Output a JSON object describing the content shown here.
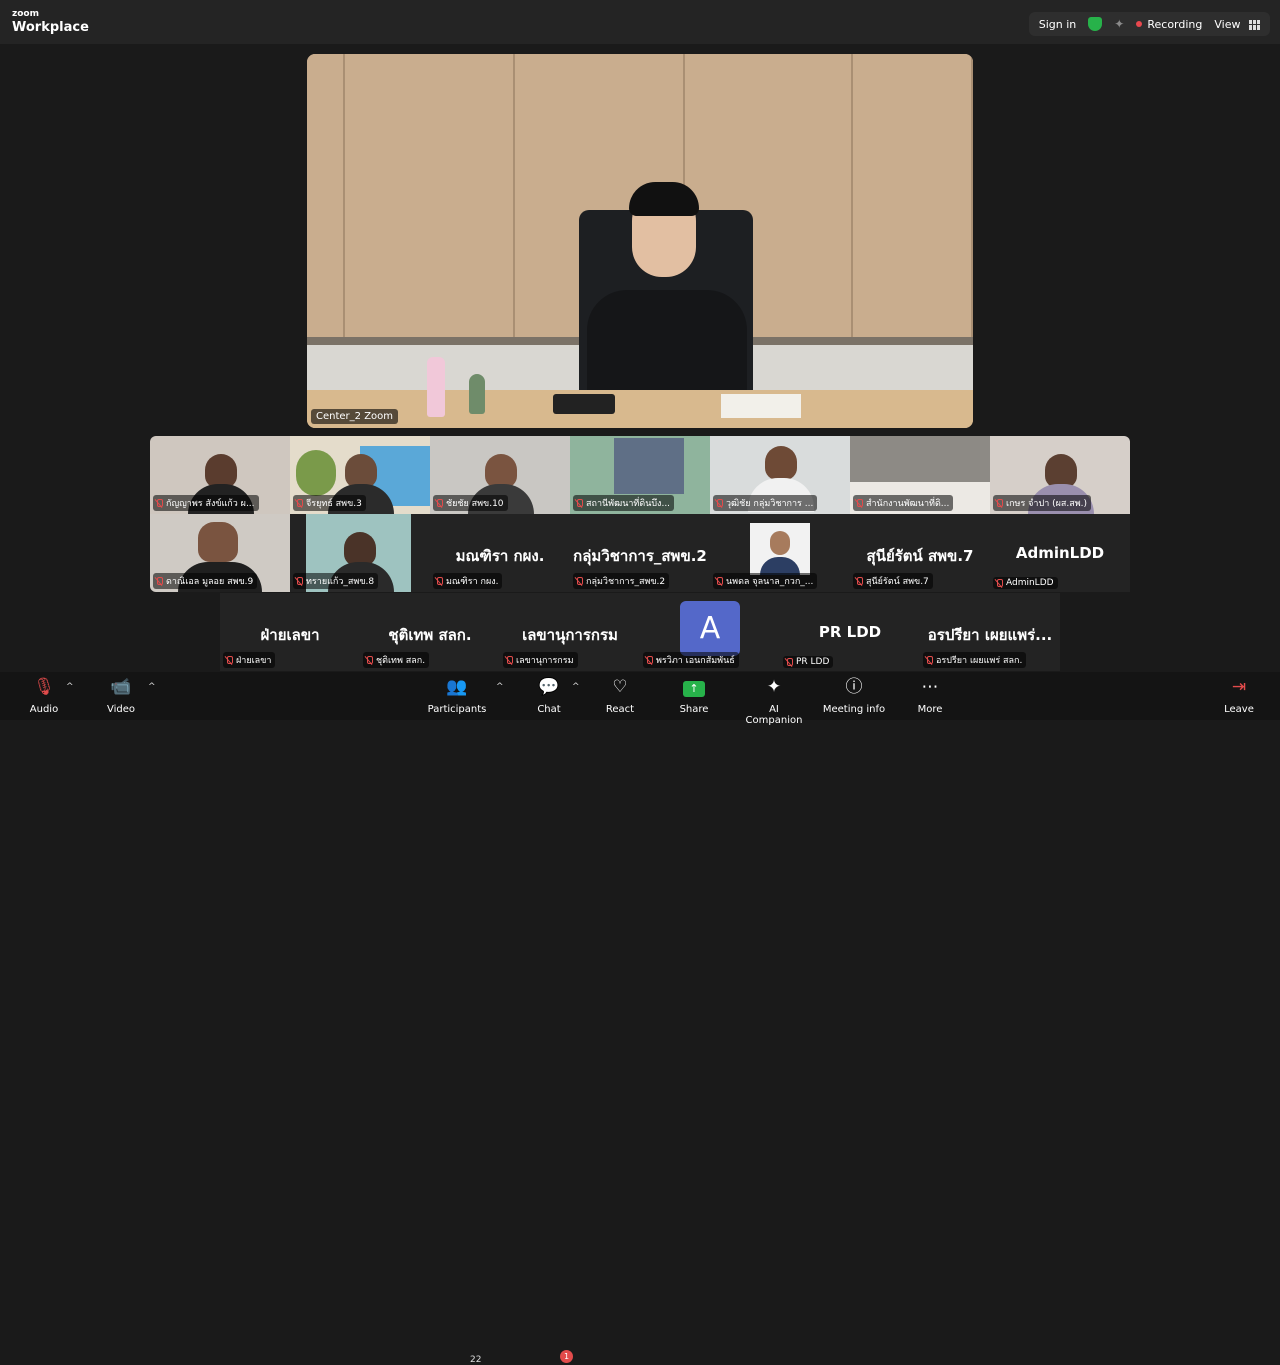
{
  "app": {
    "brand_small": "zoom",
    "brand_big": "Workplace"
  },
  "topbar": {
    "sign_in": "Sign in",
    "recording": "Recording",
    "view": "View"
  },
  "main_video": {
    "name": "Center_2 Zoom"
  },
  "strip1": [
    "กัญญาพร สังข์แก้ว ผ...",
    "จีรยุทธ์ สพข.3",
    "ชัยชัย สพข.10",
    "สถานีพัฒนาที่ดินบึง...",
    "วุฒิชัย กลุ่มวิชาการ ...",
    "สำนักงานพัฒนาที่ดิ...",
    "เกษร จำปา (ผส.สพ.)"
  ],
  "strip2_video": [
    "ดาณิเอล มูลอย สพข.9",
    "ทรายแก้ว_สพข.8"
  ],
  "strip2_named": [
    {
      "display": "มณฑิรา กผง.",
      "label": "มณฑิรา กผง."
    },
    {
      "display": "กลุ่มวิชาการ_สพข.2",
      "label": "กลุ่มวิชาการ_สพข.2"
    },
    {
      "display": "",
      "label": "นพดล จุลนาล_กวก_..."
    },
    {
      "display": "สุนีย์รัตน์ สพข.7",
      "label": "สุนีย์รัตน์ สพข.7"
    },
    {
      "display": "AdminLDD",
      "label": "AdminLDD"
    }
  ],
  "strip3": [
    {
      "display": "ฝ่ายเลขา",
      "label": "ฝ่ายเลขา"
    },
    {
      "display": "ชุติเทพ สลก.",
      "label": "ชุติเทพ สลก."
    },
    {
      "display": "เลขานุการกรม",
      "label": "เลขานุการกรม"
    },
    {
      "display": "A",
      "label": "พรวิภา เอนกสัมพันธ์"
    },
    {
      "display": "PR LDD",
      "label": "PR LDD"
    },
    {
      "display": "อรปรียา เผยแพร่...",
      "label": "อรปรียา เผยแพร่ สลก."
    }
  ],
  "toolbar": {
    "audio": "Audio",
    "video": "Video",
    "participants": "Participants",
    "participants_count": "22",
    "chat": "Chat",
    "chat_badge": "1",
    "react": "React",
    "share": "Share",
    "ai_companion": "AI Companion",
    "meeting_info": "Meeting info",
    "more": "More",
    "leave": "Leave"
  },
  "colors": {
    "recording_dot": "#e8484e",
    "share_green": "#27b24a",
    "avatar_blue": "#5468c9",
    "mute_red": "#e24b4b"
  }
}
